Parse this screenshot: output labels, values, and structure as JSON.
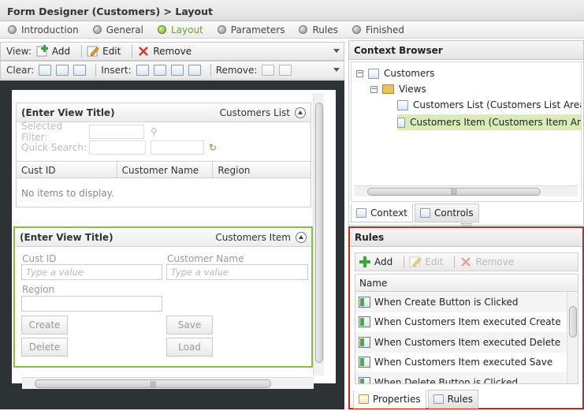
{
  "window": {
    "title": "Form Designer (Customers) > Layout"
  },
  "steps": [
    {
      "label": "Introduction",
      "active": false
    },
    {
      "label": "General",
      "active": false
    },
    {
      "label": "Layout",
      "active": true
    },
    {
      "label": "Parameters",
      "active": false
    },
    {
      "label": "Rules",
      "active": false
    },
    {
      "label": "Finished",
      "active": false
    }
  ],
  "toolbar1": {
    "view_label": "View:",
    "add": "Add",
    "edit": "Edit",
    "remove": "Remove"
  },
  "toolbar2": {
    "clear_label": "Clear:",
    "insert_label": "Insert:",
    "remove_label": "Remove:"
  },
  "view_list": {
    "title": "(Enter View Title)",
    "name": "Customers List",
    "selected_filter_label": "Selected Filter:",
    "quick_search_label": "Quick Search:",
    "columns": [
      "Cust ID",
      "Customer Name",
      "Region"
    ],
    "empty_text": "No items to display."
  },
  "view_item": {
    "title": "(Enter View Title)",
    "name": "Customers Item",
    "cust_id_label": "Cust ID",
    "cust_id_placeholder": "Type a value",
    "customer_name_label": "Customer Name",
    "customer_name_placeholder": "Type a value",
    "region_label": "Region",
    "buttons": {
      "create": "Create",
      "save": "Save",
      "delete": "Delete",
      "load": "Load"
    }
  },
  "context_browser": {
    "title": "Context Browser",
    "root": "Customers",
    "folder": "Views",
    "items": [
      "Customers List (Customers List Area",
      "Customers Item (Customers Item Are"
    ],
    "tabs": [
      "Context",
      "Controls"
    ]
  },
  "rules_panel": {
    "title": "Rules",
    "toolbar": {
      "add": "Add",
      "edit": "Edit",
      "remove": "Remove"
    },
    "column_header": "Name",
    "items": [
      "When Create Button is Clicked",
      "When Customers Item executed Create",
      "When Customers Item executed Delete",
      "When Customers Item executed Save",
      "When Delete Button is Clicked"
    ],
    "tabs": [
      "Properties",
      "Rules"
    ]
  },
  "colors": {
    "accent_green": "#8bbf44",
    "highlight_red": "#d2231f",
    "canvas_dark": "#2d3234"
  }
}
